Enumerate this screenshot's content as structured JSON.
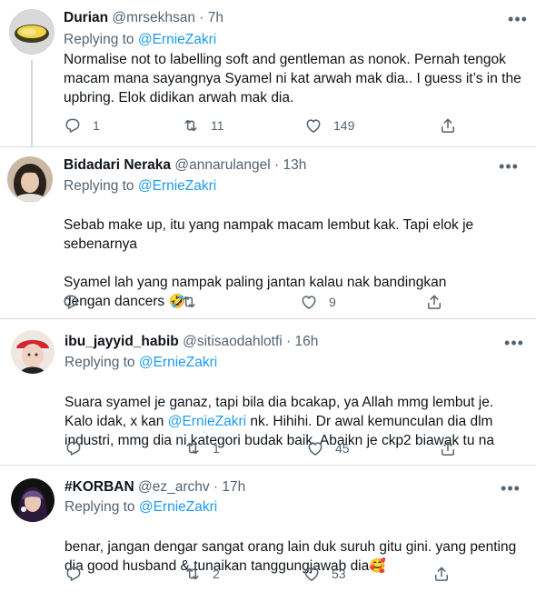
{
  "tweets": [
    {
      "display_name": "Durian",
      "handle": "@mrsekhsan",
      "dot": "·",
      "time": "7h",
      "replying_label": "Replying to",
      "replying_to": "@ErnieZakri",
      "body": "Normalise not to labelling soft and gentleman as nonok. Pernah tengok macam mana sayangnya Syamel ni kat arwah mak dia.. I guess it’s in the upbring. Elok didikan arwah mak dia.",
      "body_tail": "",
      "emoji": "",
      "replies": "1",
      "retweets": "11",
      "likes": "149",
      "more": "•••"
    },
    {
      "display_name": "Bidadari Neraka",
      "handle": "@annarulangel",
      "dot": "·",
      "time": "13h",
      "replying_label": "Replying to",
      "replying_to": "@ErnieZakri",
      "body": "Sebab make up, itu yang nampak macam lembut kak. Tapi elok je sebenarnya\n\nSyamel lah yang nampak paling jantan kalau nak bandingkan dengan dancers ",
      "body_tail": "",
      "emoji": "🤣",
      "replies": "",
      "retweets": "",
      "likes": "9",
      "more": "•••"
    },
    {
      "display_name": "ibu_jayyid_habib",
      "handle": "@sitisaodahlotfi",
      "dot": "·",
      "time": "16h",
      "replying_label": "Replying to",
      "replying_to": "@ErnieZakri",
      "body": "Suara syamel je ganaz, tapi bila dia bcakap, ya Allah mmg lembut je. Kalo idak, x kan ",
      "body_mention": "@ErnieZakri",
      "body_tail": " nk. Hihihi. Dr awal kemunculan dia dlm industri, mmg dia ni kategori budak baik. Abaikn je ckp2 biawak tu na",
      "emoji": "",
      "replies": "",
      "retweets": "1",
      "likes": "45",
      "more": "•••"
    },
    {
      "display_name": "#KORBAN",
      "handle": "@ez_archv",
      "dot": "·",
      "time": "17h",
      "replying_label": "Replying to",
      "replying_to": "@ErnieZakri",
      "body": "benar, jangan dengar sangat orang lain duk suruh gitu gini. yang penting dia good husband & tunaikan tanggungjawab dia",
      "body_tail": "",
      "emoji": "🥰",
      "replies": "",
      "retweets": "2",
      "likes": "53",
      "more": "•••"
    }
  ],
  "icons": {
    "reply": "reply-icon",
    "retweet": "retweet-icon",
    "like": "heart-icon",
    "share": "share-icon",
    "more": "more-icon"
  },
  "colors": {
    "link": "#1d9bf0",
    "secondary": "#536471",
    "text": "#0f1419",
    "divider": "#d7dce0"
  }
}
